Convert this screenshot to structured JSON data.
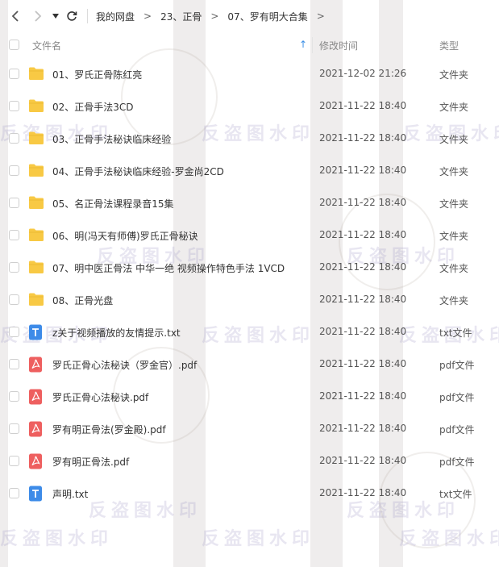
{
  "toolbar": {
    "back_icon": "chevron-left-icon",
    "forward_icon": "chevron-right-icon",
    "history_icon": "caret-down-icon",
    "refresh_icon": "refresh-icon"
  },
  "breadcrumb": {
    "items": [
      "我的网盘",
      "23、正骨",
      "07、罗有明大合集"
    ],
    "separator": ">"
  },
  "header": {
    "name_label": "文件名",
    "time_label": "修改时间",
    "type_label": "类型",
    "sort_indicator": "↑"
  },
  "files": [
    {
      "name": "01、罗氏正骨陈红亮",
      "time": "2021-12-02 21:26",
      "type": "文件夹",
      "icon": "folder-icon"
    },
    {
      "name": "02、正骨手法3CD",
      "time": "2021-11-22 18:40",
      "type": "文件夹",
      "icon": "folder-icon"
    },
    {
      "name": "03、正骨手法秘诀临床经验",
      "time": "2021-11-22 18:40",
      "type": "文件夹",
      "icon": "folder-icon"
    },
    {
      "name": "04、正骨手法秘诀临床经验-罗金尚2CD",
      "time": "2021-11-22 18:40",
      "type": "文件夹",
      "icon": "folder-icon"
    },
    {
      "name": "05、名正骨法课程录音15集",
      "time": "2021-11-22 18:40",
      "type": "文件夹",
      "icon": "folder-icon"
    },
    {
      "name": "06、明(冯天有师傅)罗氏正骨秘诀",
      "time": "2021-11-22 18:40",
      "type": "文件夹",
      "icon": "folder-icon"
    },
    {
      "name": "07、明中医正骨法 中华一绝 视频操作特色手法 1VCD",
      "time": "2021-11-22 18:40",
      "type": "文件夹",
      "icon": "folder-icon"
    },
    {
      "name": "08、正骨光盘",
      "time": "2021-11-22 18:40",
      "type": "文件夹",
      "icon": "folder-icon"
    },
    {
      "name": "z关于视频播放的友情提示.txt",
      "time": "2021-11-22 18:40",
      "type": "txt文件",
      "icon": "txt-file-icon"
    },
    {
      "name": "罗氏正骨心法秘诀（罗金官）.pdf",
      "time": "2021-11-22 18:40",
      "type": "pdf文件",
      "icon": "pdf-file-icon"
    },
    {
      "name": "罗氏正骨心法秘诀.pdf",
      "time": "2021-11-22 18:40",
      "type": "pdf文件",
      "icon": "pdf-file-icon"
    },
    {
      "name": "罗有明正骨法(罗金殿).pdf",
      "time": "2021-11-22 18:40",
      "type": "pdf文件",
      "icon": "pdf-file-icon"
    },
    {
      "name": "罗有明正骨法.pdf",
      "time": "2021-11-22 18:40",
      "type": "pdf文件",
      "icon": "pdf-file-icon"
    },
    {
      "name": "声明.txt",
      "time": "2021-11-22 18:40",
      "type": "txt文件",
      "icon": "txt-file-icon"
    }
  ],
  "watermark": {
    "text": "反盗图水印"
  },
  "colors": {
    "folder": "#f8c944",
    "pdf": "#ee5f5f",
    "txt": "#3d8be8",
    "accent": "#3a8ee6"
  }
}
